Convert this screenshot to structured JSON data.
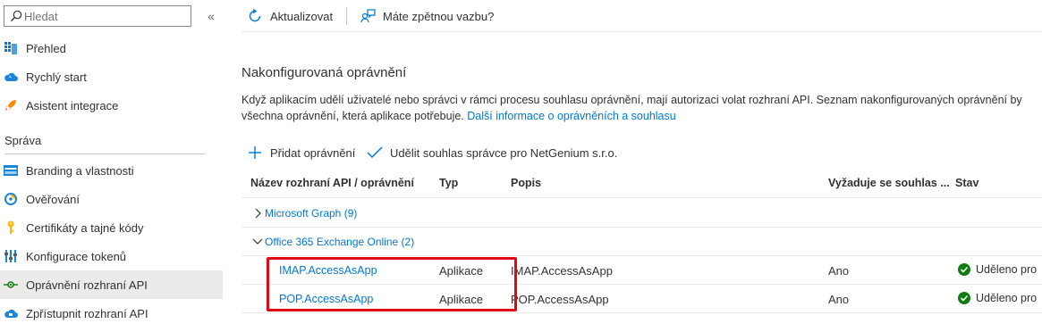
{
  "sidebar": {
    "search": {
      "placeholder": "Hledat",
      "value": ""
    },
    "collapse_label": "«",
    "items_top": [
      {
        "label": "Přehled",
        "icon": "overview-grid-icon"
      },
      {
        "label": "Rychlý start",
        "icon": "cloud-icon"
      },
      {
        "label": "Asistent integrace",
        "icon": "rocket-icon"
      }
    ],
    "section_title": "Správa",
    "items_manage": [
      {
        "label": "Branding a vlastnosti",
        "icon": "branding-icon"
      },
      {
        "label": "Ověřování",
        "icon": "authentication-icon"
      },
      {
        "label": "Certifikáty a tajné kódy",
        "icon": "key-icon"
      },
      {
        "label": "Konfigurace tokenů",
        "icon": "token-config-icon"
      },
      {
        "label": "Oprávnění rozhraní API",
        "icon": "api-permissions-icon",
        "active": true
      },
      {
        "label": "Zpřístupnit rozhraní API",
        "icon": "expose-api-cloud-icon"
      }
    ]
  },
  "toolbar": {
    "refresh_label": "Aktualizovat",
    "feedback_label": "Máte zpětnou vazbu?"
  },
  "main": {
    "title": "Nakonfigurovaná oprávnění",
    "description_line1": "Když aplikacím udělí uživatelé nebo správci v rámci procesu souhlasu oprávnění, mají autorizaci volat rozhraní API. Seznam nakonfigurovaných oprávnění by",
    "description_line2": "všechna oprávnění, která aplikace potřebuje. ",
    "description_link": "Další informace o oprávněních a souhlasu",
    "add_permission_label": "Přidat oprávnění",
    "grant_consent_label": "Udělit souhlas správce pro NetGenium s.r.o."
  },
  "table": {
    "columns": [
      "Název rozhraní API / oprávnění",
      "Typ",
      "Popis",
      "Vyžaduje se souhlas ...",
      "Stav"
    ],
    "groups": [
      {
        "label": "Microsoft Graph (9)",
        "expanded": false
      },
      {
        "label": "Office 365 Exchange Online (2)",
        "expanded": true
      }
    ],
    "rows": [
      {
        "name": "IMAP.AccessAsApp",
        "type": "Aplikace",
        "description": "IMAP.AccessAsApp",
        "admin_consent": "Ano",
        "status": "Uděleno pro"
      },
      {
        "name": "POP.AccessAsApp",
        "type": "Aplikace",
        "description": "POP.AccessAsApp",
        "admin_consent": "Ano",
        "status": "Uděleno pro"
      }
    ]
  },
  "colors": {
    "accent": "#0078d4",
    "success": "#107c10",
    "highlight": "#e30613",
    "active_bg": "#edebe9"
  }
}
